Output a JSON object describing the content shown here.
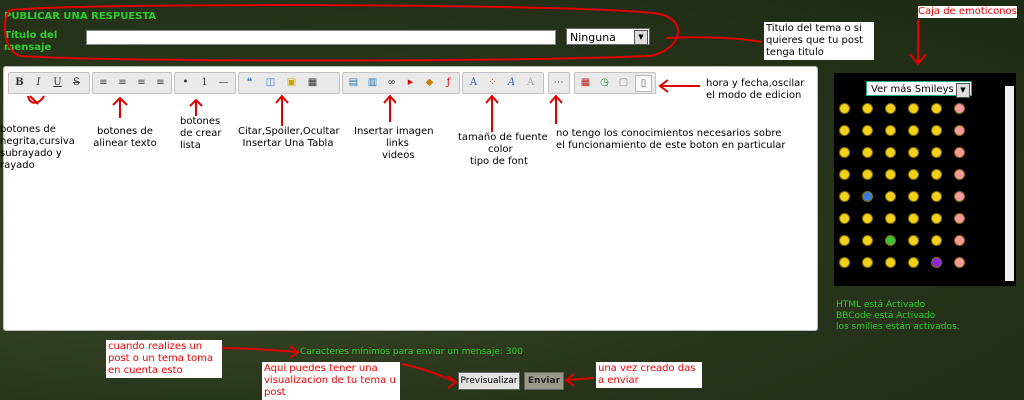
{
  "form": {
    "section_title": "PUBLICAR UNA RESPUESTA",
    "subject_label": "Título del mensaje",
    "subject_value": "",
    "icon_select_value": "Ninguna"
  },
  "smileys": {
    "header": "Caja de emoticonos",
    "more_select": "Ver más Smileys"
  },
  "status": {
    "html": "HTML está Activado",
    "bbcode": "BBCode está Activado",
    "smilies": "los smilies están activados."
  },
  "min_chars": "Caracteres mínimos para enviar un mensaje: 300",
  "buttons": {
    "preview": "Previsualizar",
    "send": "Enviar"
  },
  "annotations": {
    "topic_title": "Titulo del tema o si quieres que tu post tenga titulo",
    "format_buttons": "botones de negrita,cursiva subrayado y rayado",
    "align_buttons": "botones de alinear texto",
    "list_buttons": "botones de crear lista",
    "quote_buttons": "Citar,Spoiler,Ocultar Insertar Una Tabla",
    "insert_line1": "Insertar   imagen",
    "insert_line2": "links",
    "insert_line3": "videos",
    "font_line1": "tamaño de fuente",
    "font_line2": "color",
    "font_line3": "tipo de font",
    "unknown_button": "no tengo los conocimientos necesarios sobre el funcionamiento de este boton en particular",
    "date_time": "hora y fecha,oscilar el modo de edicion",
    "min_chars_note": "cuando realizes un post o un tema toma en cuenta esto",
    "preview_note": "Aqui puedes tener una visualizacion de tu tema u post",
    "send_note": "una vez creado das a enviar"
  },
  "toolbar": {
    "b": "B",
    "i": "I",
    "u": "U",
    "s": "S"
  },
  "colors": {
    "green": "#2ecf2e",
    "red": "#e00000",
    "background": "#2d3a1e"
  }
}
